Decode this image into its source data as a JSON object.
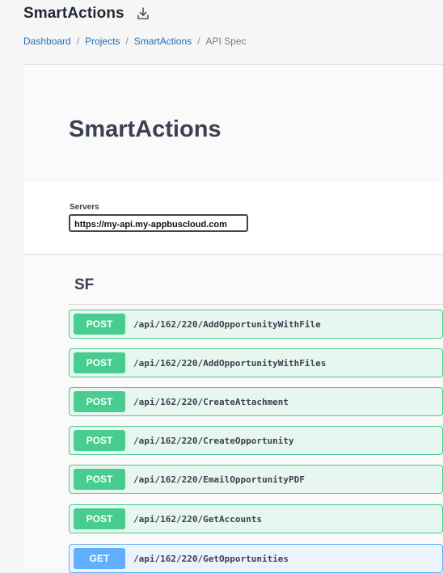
{
  "header": {
    "title": "SmartActions",
    "download_icon": "download-icon",
    "breadcrumb": [
      {
        "label": "Dashboard"
      },
      {
        "label": "Projects"
      },
      {
        "label": "SmartActions"
      },
      {
        "label": "API Spec"
      }
    ],
    "separator": "/"
  },
  "spec": {
    "title": "SmartActions",
    "servers_label": "Servers",
    "selected_server": "https://my-api.my-appbuscloud.com",
    "tag": "SF",
    "operations": [
      {
        "method": "POST",
        "path": "/api/162/220/AddOpportunityWithFile"
      },
      {
        "method": "POST",
        "path": "/api/162/220/AddOpportunityWithFiles"
      },
      {
        "method": "POST",
        "path": "/api/162/220/CreateAttachment"
      },
      {
        "method": "POST",
        "path": "/api/162/220/CreateOpportunity"
      },
      {
        "method": "POST",
        "path": "/api/162/220/EmailOpportunityPDF"
      },
      {
        "method": "POST",
        "path": "/api/162/220/GetAccounts"
      },
      {
        "method": "GET",
        "path": "/api/162/220/GetOpportunities"
      }
    ]
  },
  "colors": {
    "post": "#49cc90",
    "get": "#61affe",
    "link": "#1f6fbf"
  }
}
